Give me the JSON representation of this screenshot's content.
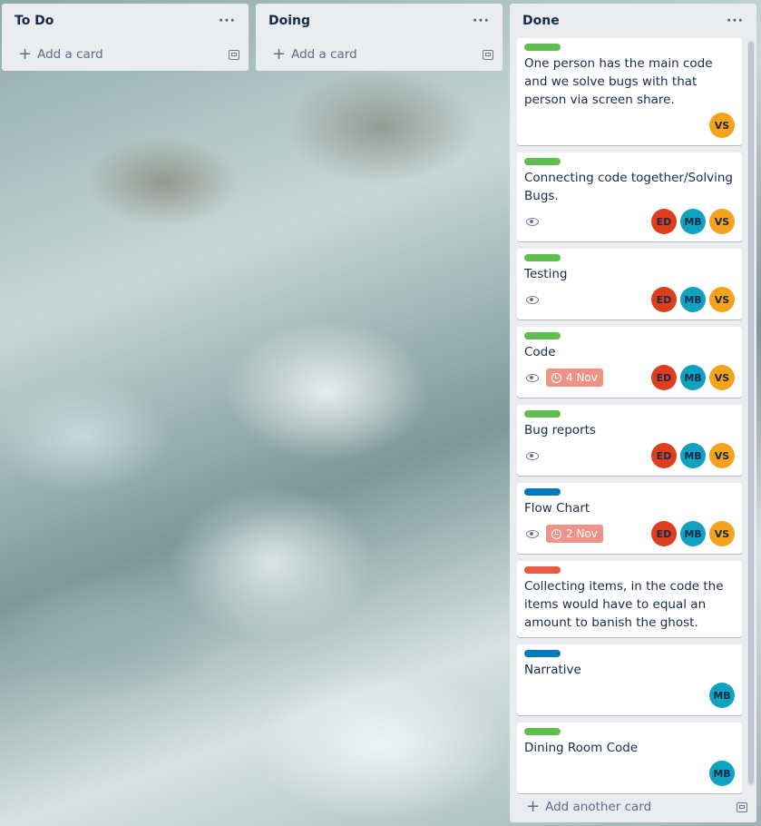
{
  "colors": {
    "label_green": "#61bd4f",
    "label_blue": "#0079bf",
    "label_red": "#eb5a46",
    "avatar_ED": "#df3e1c",
    "avatar_MB": "#10a2bf",
    "avatar_VS": "#f5a21d",
    "due_overdue": "#ec9488"
  },
  "lists": [
    {
      "title": "To Do",
      "menu": "···",
      "add_label": "Add a card",
      "add_icon": "plus-icon",
      "template_icon": "card-template-icon"
    },
    {
      "title": "Doing",
      "menu": "···",
      "add_label": "Add a card",
      "add_icon": "plus-icon",
      "template_icon": "card-template-icon"
    },
    {
      "title": "Done",
      "menu": "···",
      "add_label": "Add another card",
      "add_icon": "plus-icon",
      "template_icon": "card-template-icon",
      "cards": [
        {
          "label": "green",
          "title": "One person has the main code and we solve bugs with that person via screen share.",
          "watch": false,
          "due": "",
          "members": [
            "VS"
          ]
        },
        {
          "label": "green",
          "title": "Connecting code together/Solving Bugs.",
          "watch": true,
          "due": "",
          "members": [
            "ED",
            "MB",
            "VS"
          ]
        },
        {
          "label": "green",
          "title": "Testing",
          "watch": true,
          "due": "",
          "members": [
            "ED",
            "MB",
            "VS"
          ]
        },
        {
          "label": "green",
          "title": "Code",
          "watch": true,
          "due": "4 Nov",
          "members": [
            "ED",
            "MB",
            "VS"
          ]
        },
        {
          "label": "green",
          "title": "Bug reports",
          "watch": true,
          "due": "",
          "members": [
            "ED",
            "MB",
            "VS"
          ]
        },
        {
          "label": "blue",
          "title": "Flow Chart",
          "watch": true,
          "due": "2 Nov",
          "members": [
            "ED",
            "MB",
            "VS"
          ]
        },
        {
          "label": "red",
          "title": "Collecting items, in the code the items would have to equal an amount to banish the ghost.",
          "watch": false,
          "due": "",
          "members": []
        },
        {
          "label": "blue",
          "title": "Narrative",
          "watch": false,
          "due": "",
          "members": [
            "MB"
          ]
        },
        {
          "label": "green",
          "title": "Dining Room Code",
          "watch": false,
          "due": "",
          "members": [
            "MB"
          ]
        }
      ]
    }
  ]
}
